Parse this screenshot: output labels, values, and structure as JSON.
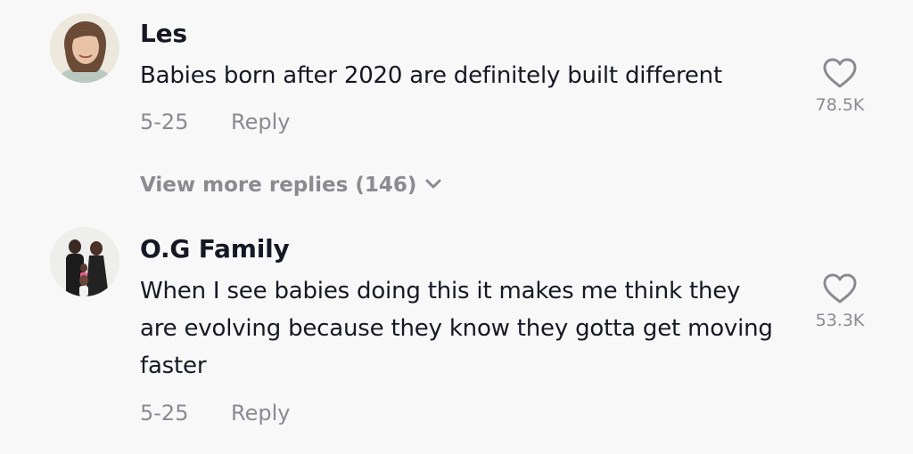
{
  "comments": [
    {
      "username": "Les",
      "text": "Babies born after 2020 are definitely built different",
      "date": "5-25",
      "reply_label": "Reply",
      "likes": "78.5K",
      "view_more": "View more replies (146)"
    },
    {
      "username": "O.G Family",
      "text": "When I see babies doing this it makes me think they are evolving because they know they gotta get moving faster",
      "date": "5-25",
      "reply_label": "Reply",
      "likes": "53.3K"
    }
  ],
  "icons": {
    "like": "heart-outline-icon",
    "expand": "chevron-down-icon"
  },
  "colors": {
    "background": "#f8f8f8",
    "primary_text": "#161823",
    "secondary_text": "#8a8b91"
  }
}
